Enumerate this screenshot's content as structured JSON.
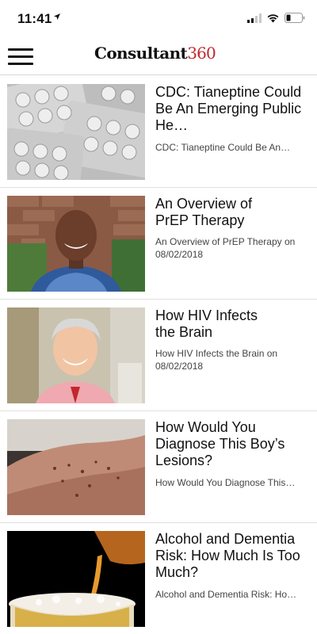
{
  "status_bar": {
    "time": "11:41"
  },
  "header": {
    "logo_text": "Consultant",
    "logo_number": "360"
  },
  "articles": [
    {
      "title": "CDC: Tianeptine Could Be An Emerging Public He…",
      "subtitle": "CDC: Tianeptine Could Be An…"
    },
    {
      "title": "An Overview of PrEP Therapy",
      "subtitle": "An Overview of PrEP Therapy on 08/02/2018"
    },
    {
      "title": "How HIV Infects the Brain",
      "subtitle": "How HIV Infects the Brain on 08/02/2018"
    },
    {
      "title": "How Would You Diagnose This Boy’s Lesions?",
      "subtitle": "How Would You Diagnose This…"
    },
    {
      "title": "Alcohol and Dementia Risk: How Much Is Too Much?",
      "subtitle": "Alcohol and Dementia Risk: Ho…"
    }
  ]
}
